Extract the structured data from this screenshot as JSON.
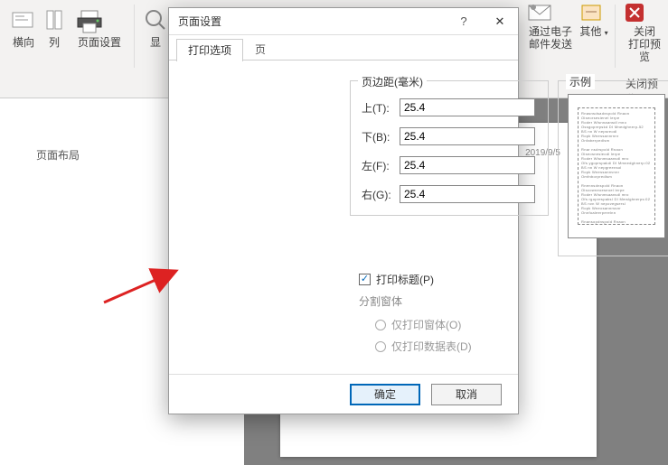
{
  "ribbon": {
    "group_label": "页面布局",
    "items": {
      "landscape": "横向",
      "columns": "列",
      "page_setup": "页面设置",
      "display": "显",
      "email1": "通过电子",
      "email2": "邮件发送",
      "other": "其他",
      "close1": "关闭",
      "close2": "打印预览",
      "close_group": "关闭预览"
    }
  },
  "dialog": {
    "title": "页面设置",
    "tabs": {
      "print_options": "打印选项",
      "page": "页"
    },
    "margins_legend": "页边距(毫米)",
    "sample_legend": "示例",
    "margins": {
      "top_label": "上(T):",
      "top": "25.4",
      "bottom_label": "下(B):",
      "bottom": "25.4",
      "left_label": "左(F):",
      "left": "25.4",
      "right_label": "右(G):",
      "right": "25.4"
    },
    "print_title": "打印标题(P)",
    "split_form": "分割窗体",
    "only_form": "仅打印窗体(O)",
    "only_data": "仅打印数据表(D)",
    "ok": "确定",
    "cancel": "取消"
  },
  "preview": {
    "date": "2019/9/5"
  }
}
